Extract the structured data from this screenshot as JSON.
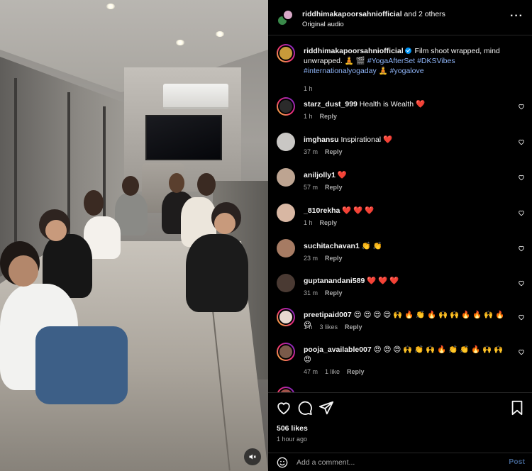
{
  "header": {
    "username": "riddhimakapoorsahniofficial",
    "collab_suffix": "and 2 others",
    "audio": "Original audio",
    "more_icon": "more-horizontal-icon"
  },
  "caption": {
    "username": "riddhimakapoorsahniofficial",
    "text": "Film shoot wrapped, mind unwrapped.",
    "emojis": "🧘 🎬",
    "tags": [
      "#YogaAfterSet",
      "#DKSVibes",
      "#internationalyogaday",
      "#yogalove"
    ],
    "trailing_emoji": "🧘",
    "time": "1 h"
  },
  "comments": [
    {
      "username": "starz_dust_999",
      "text": "Health is Wealth ❤️",
      "time": "1 h",
      "likes": "",
      "reply": "Reply"
    },
    {
      "username": "imghansu",
      "text": "Inspirational ❤️",
      "time": "37 m",
      "likes": "",
      "reply": "Reply"
    },
    {
      "username": "aniljolly1",
      "text": "❤️",
      "time": "57 m",
      "likes": "",
      "reply": "Reply"
    },
    {
      "username": "_810rekha",
      "text": "❤️ ❤️ ❤️",
      "time": "1 h",
      "likes": "",
      "reply": "Reply"
    },
    {
      "username": "suchitachavan1",
      "text": "👏 👏",
      "time": "23 m",
      "likes": "",
      "reply": "Reply"
    },
    {
      "username": "guptanandani589",
      "text": "❤️ ❤️ ❤️",
      "time": "31 m",
      "likes": "",
      "reply": "Reply"
    },
    {
      "username": "preetipaid007",
      "text": "😍 😍 😍 😍 🙌 🔥 👏 🔥 🙌 🙌 🔥 🔥 🙌 🔥 😍",
      "time": "1 h",
      "likes": "3 likes",
      "reply": "Reply"
    },
    {
      "username": "pooja_available007",
      "text": "😍 😍 😍 🙌 👏 🙌 🔥 👏 👏 🔥 🙌 🙌 😍",
      "time": "47 m",
      "likes": "1 like",
      "reply": "Reply"
    }
  ],
  "footer": {
    "likes": "506 likes",
    "time_ago": "1 hour ago",
    "comment_placeholder": "Add a comment...",
    "post_label": "Post"
  },
  "colors": {
    "accent_blue": "#0095f6",
    "heart_red": "#ff3040",
    "hashtag": "#8eb4f7",
    "muted": "#a8a8a8"
  }
}
